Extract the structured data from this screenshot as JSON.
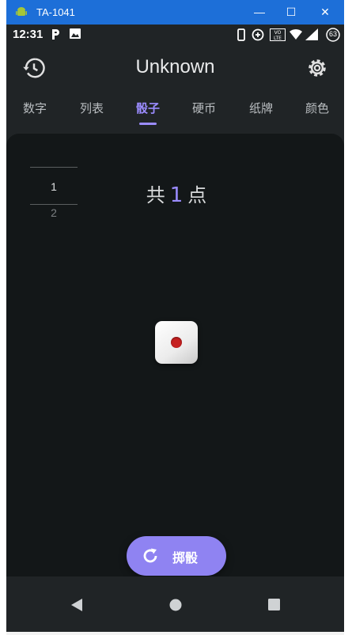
{
  "window": {
    "title": "TA-1041",
    "minimize": "—",
    "maximize": "☐",
    "close": "✕"
  },
  "status_bar": {
    "time": "12:31",
    "battery": "63"
  },
  "app_bar": {
    "title": "Unknown"
  },
  "tabs": [
    {
      "label": "数字"
    },
    {
      "label": "列表"
    },
    {
      "label": "骰子"
    },
    {
      "label": "硬币"
    },
    {
      "label": "纸牌"
    },
    {
      "label": "颜色"
    }
  ],
  "active_tab_index": 2,
  "history": {
    "current": "1",
    "previous": "2"
  },
  "result": {
    "prefix": "共",
    "total": "1",
    "suffix": "点"
  },
  "dice": [
    {
      "value": 1
    }
  ],
  "roll_button": {
    "label": "掷骰"
  },
  "colors": {
    "accent": "#9b8cff",
    "button": "#8f83f2",
    "pip": "#c62020",
    "background": "#131718"
  }
}
